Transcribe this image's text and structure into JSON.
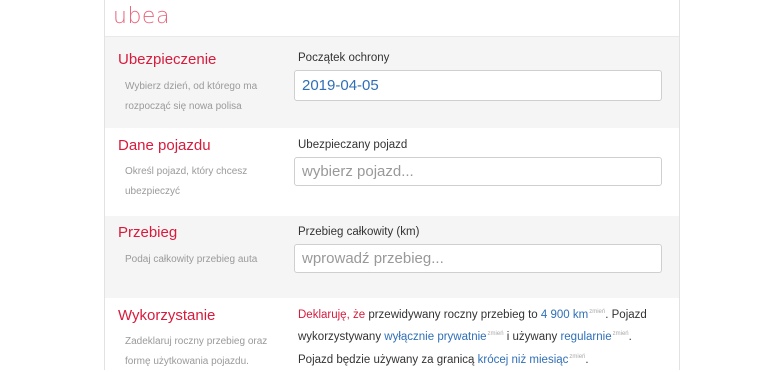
{
  "header": {
    "logo": "ubea"
  },
  "sections": {
    "insurance": {
      "title": "Ubezpieczenie",
      "description": "Wybierz dzień, od którego ma rozpocząć się nowa polisa",
      "label": "Początek ochrony",
      "value": "2019-04-05"
    },
    "vehicle": {
      "title": "Dane pojazdu",
      "description": "Określ pojazd, który chcesz ubezpieczyć",
      "label": "Ubezpieczany pojazd",
      "placeholder": "wybierz pojazd..."
    },
    "mileage": {
      "title": "Przebieg",
      "description": "Podaj całkowity przebieg auta",
      "label": "Przebieg całkowity (km)",
      "placeholder": "wprowadź przebieg..."
    },
    "usage": {
      "title": "Wykorzystanie",
      "description": "Zadeklaruj roczny przebieg oraz formę użytkowania pojazdu.",
      "t_declare": "Deklaruję, że",
      "t1": " przewidywany roczny przebieg to ",
      "annual_mileage": "4 900 km",
      "change": "zmień",
      "t2": ". Pojazd wykorzystywany ",
      "usage_type": "wyłącznie prywatnie",
      "t3": " i używany ",
      "frequency": "regularnie",
      "t4": ". Pojazd będzie używany za granicą ",
      "abroad": "krócej niż miesiąc",
      "t5": "."
    }
  }
}
